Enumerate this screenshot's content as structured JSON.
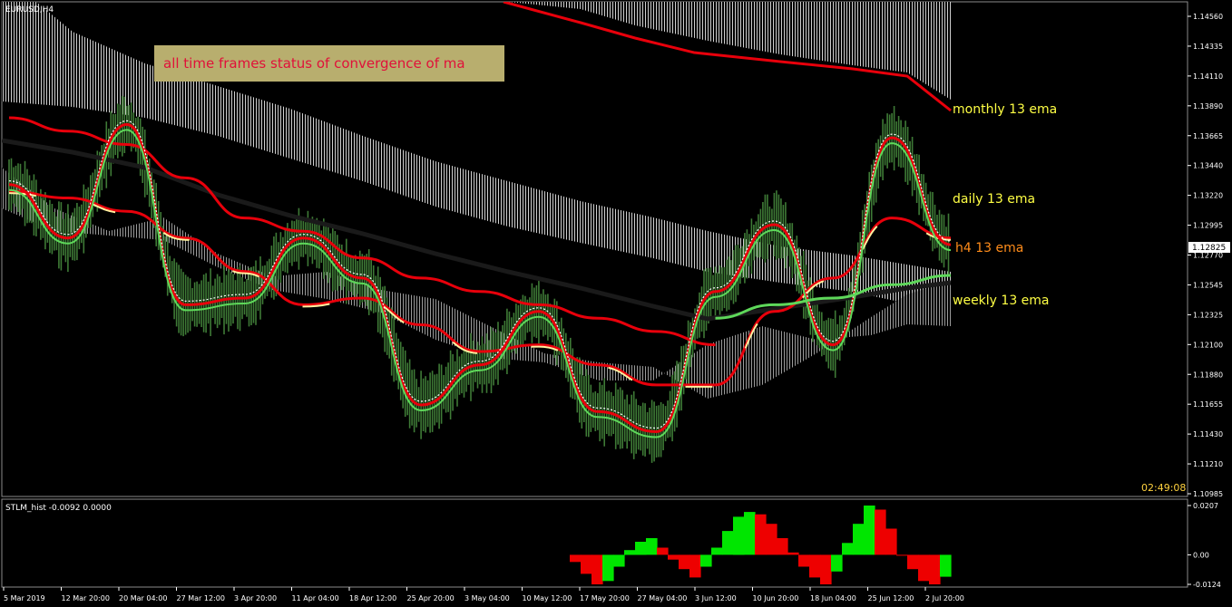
{
  "window": {
    "symbol_title": "EURUSD,H4",
    "clock": "02:49:08"
  },
  "annotation": {
    "text": "all time frames status of convergence of ma",
    "bg_color": "#b8ae6e",
    "text_color": "#e0113a"
  },
  "main_chart": {
    "price_axis": {
      "ticks": [
        "1.14560",
        "1.14335",
        "1.14110",
        "1.13890",
        "1.13665",
        "1.13440",
        "1.13220",
        "1.12995",
        "1.12770",
        "1.12545",
        "1.12325",
        "1.12100",
        "1.11880",
        "1.11655",
        "1.11430",
        "1.11210",
        "1.10985"
      ],
      "current_price": "1.12825"
    },
    "time_axis": {
      "ticks": [
        "5 Mar 2019",
        "12 Mar 20:00",
        "20 Mar 04:00",
        "27 Mar 12:00",
        "3 Apr 20:00",
        "11 Apr 04:00",
        "18 Apr 12:00",
        "25 Apr 20:00",
        "3 May 04:00",
        "10 May 12:00",
        "17 May 20:00",
        "27 May 04:00",
        "3 Jun 12:00",
        "10 Jun 20:00",
        "18 Jun 04:00",
        "25 Jun 12:00",
        "2 Jul 20:00"
      ]
    },
    "legend_labels": [
      {
        "text": "monthly 13 ema",
        "color": "#ffff44"
      },
      {
        "text": "daily 13 ema",
        "color": "#ffff44"
      },
      {
        "text": "h4 13 ema",
        "color": "#ff8c1a"
      },
      {
        "text": "weekly 13 ema",
        "color": "#ffff44"
      }
    ],
    "colors": {
      "price": "#3e7a36",
      "ema_red": "#e8000b",
      "ema_green": "#5ed85a",
      "converge": "#ffef9e",
      "band": "#d8d8d8"
    }
  },
  "sub_chart": {
    "title": "STLM_hist -0.0092 0.0000",
    "axis_ticks": [
      "0.0207",
      "0.00",
      "-0.0124"
    ],
    "colors": {
      "positive": "#00e600",
      "negative": "#ee0000"
    }
  },
  "chart_data": [
    {
      "type": "line",
      "title": "EURUSD,H4",
      "x": [
        "5 Mar 2019",
        "12 Mar 20:00",
        "20 Mar 04:00",
        "27 Mar 12:00",
        "3 Apr 20:00",
        "11 Apr 04:00",
        "18 Apr 12:00",
        "25 Apr 20:00",
        "3 May 04:00",
        "10 May 12:00",
        "17 May 20:00",
        "27 May 04:00",
        "3 Jun 12:00",
        "10 Jun 20:00",
        "18 Jun 04:00",
        "25 Jun 12:00",
        "2 Jul 20:00"
      ],
      "ylim": [
        1.10985,
        1.1456
      ],
      "series": [
        {
          "name": "monthly 13 ema",
          "values": [
            1.138,
            1.137,
            1.136,
            1.1335,
            1.1305,
            1.1295,
            1.1275,
            1.126,
            1.125,
            1.124,
            1.123,
            1.122,
            1.121,
            null,
            null,
            null,
            null
          ]
        },
        {
          "name": "daily 13 ema",
          "values": [
            1.1325,
            1.132,
            1.131,
            1.129,
            1.1265,
            1.124,
            1.1245,
            1.1225,
            1.1205,
            1.121,
            1.1195,
            1.118,
            1.118,
            1.1235,
            1.126,
            1.1305,
            1.129
          ]
        },
        {
          "name": "h4 13 ema",
          "values": [
            1.133,
            1.129,
            1.1375,
            1.124,
            1.1245,
            1.129,
            1.126,
            1.1165,
            1.1195,
            1.1235,
            1.116,
            1.1145,
            1.125,
            1.13,
            1.121,
            1.1365,
            1.1285
          ]
        },
        {
          "name": "weekly 13 ema",
          "values": [
            null,
            null,
            null,
            null,
            null,
            null,
            null,
            null,
            null,
            null,
            null,
            null,
            1.123,
            1.124,
            1.1245,
            1.1255,
            1.1262
          ]
        }
      ]
    },
    {
      "type": "bar",
      "title": "STLM_hist -0.0092 0.0000",
      "ylim": [
        -0.0124,
        0.0207
      ],
      "values": [
        -0.003,
        -0.008,
        -0.0124,
        -0.011,
        -0.005,
        0.002,
        0.0055,
        0.007,
        0.003,
        -0.002,
        -0.006,
        -0.0095,
        -0.005,
        0.003,
        0.01,
        0.016,
        0.018,
        0.017,
        0.013,
        0.007,
        0.001,
        -0.005,
        -0.0095,
        -0.0124,
        -0.007,
        0.005,
        0.013,
        0.0207,
        0.019,
        0.011,
        0.0,
        -0.006,
        -0.011,
        -0.0124,
        -0.0092
      ]
    }
  ]
}
